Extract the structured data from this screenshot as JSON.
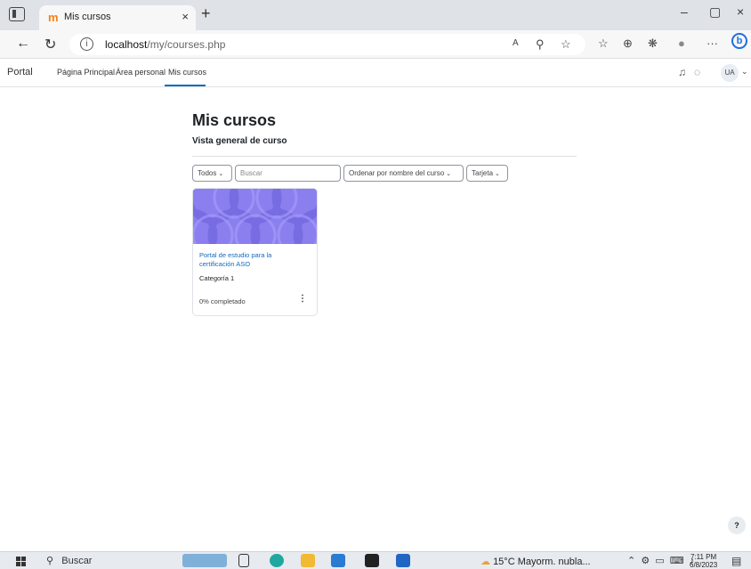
{
  "browser": {
    "tab_title": "Mis cursos",
    "url_host": "localhost",
    "url_path": "/my/courses.php",
    "new_tab_glyph": "+",
    "close_glyph": "×"
  },
  "moodle_nav": {
    "brand": "Portal",
    "links": [
      "Página Principal",
      "Área personal",
      "Mis cursos"
    ],
    "active_link": "Mis cursos",
    "user_initials": "UA"
  },
  "page": {
    "title": "Mis cursos",
    "subtitle": "Vista general de curso"
  },
  "controls": {
    "filter_label": "Todos",
    "search_placeholder": "Buscar",
    "sort_label": "Ordenar por nombre del curso",
    "view_label": "Tarjeta"
  },
  "courses": [
    {
      "name": "Portal de estudio para la certificación ASO",
      "category": "Categoría 1",
      "progress_text": "0% completado",
      "progress": 0,
      "image_color": "#8b7ff0"
    }
  ],
  "help": {
    "label": "?"
  },
  "taskbar": {
    "search_label": "Buscar",
    "weather": "15°C  Mayorm. nubla...",
    "time": "7:11 PM",
    "date": "6/8/2023"
  },
  "colors": {
    "accent": "#0f6cbf",
    "tabstrip": "#dfe3e8",
    "course_image": "#8b7ff0"
  }
}
